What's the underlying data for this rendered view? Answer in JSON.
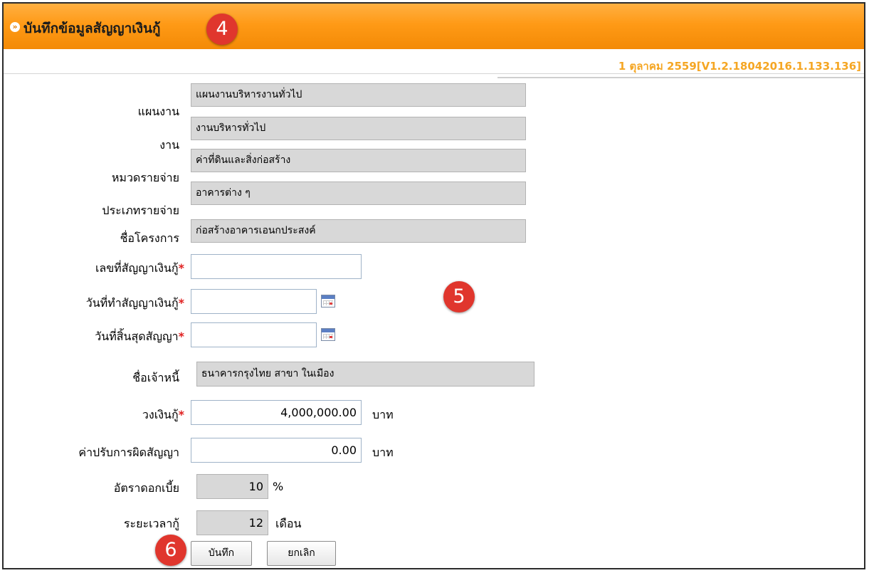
{
  "header": {
    "title": "บันทึกข้อมูลสัญญาเงินกู้",
    "arrow_icon": "circle-double-arrow-icon",
    "bg_color": "#f7950e"
  },
  "version_text": "1 ตุลาคม 2559[V1.2.18042016.1.133.136]",
  "badges": {
    "b4": "4",
    "b5": "5",
    "b6": "6"
  },
  "form": {
    "plan": {
      "label": "แผนงาน",
      "value": "แผนงานบริหารงานทั่วไป"
    },
    "job": {
      "label": "งาน",
      "value": "งานบริหารทั่วไป"
    },
    "expense_category": {
      "label": "หมวดรายจ่าย",
      "value": "ค่าที่ดินและสิ่งก่อสร้าง"
    },
    "expense_type": {
      "label": "ประเภทรายจ่าย",
      "value": "อาคารต่าง ๆ"
    },
    "project_name": {
      "label": "ชื่อโครงการ",
      "value": "ก่อสร้างอาคารเอนกประสงค์"
    },
    "contract_no": {
      "label": "เลขที่สัญญาเงินกู้",
      "required": "*",
      "value": ""
    },
    "contract_date": {
      "label": "วันที่ทำสัญญาเงินกู้",
      "required": "*",
      "value": "",
      "icon": "calendar-icon"
    },
    "end_date": {
      "label": "วันที่สิ้นสุดสัญญา",
      "required": "*",
      "value": "",
      "icon": "calendar-icon"
    },
    "creditor": {
      "label": "ชื่อเจ้าหนี้",
      "value": "ธนาคารกรุงไทย สาขา ในเมือง"
    },
    "loan_amount": {
      "label": "วงเงินกู้",
      "required": "*",
      "value": "4,000,000.00",
      "unit": "บาท"
    },
    "penalty": {
      "label": "ค่าปรับการผิดสัญญา",
      "value": "0.00",
      "unit": "บาท"
    },
    "interest_rate": {
      "label": "อัตราดอกเบี้ย",
      "value": "10",
      "unit": "%"
    },
    "loan_period": {
      "label": "ระยะเวลากู้",
      "value": "12",
      "unit": "เดือน"
    }
  },
  "buttons": {
    "save": "บันทึก",
    "cancel": "ยกเลิก"
  }
}
